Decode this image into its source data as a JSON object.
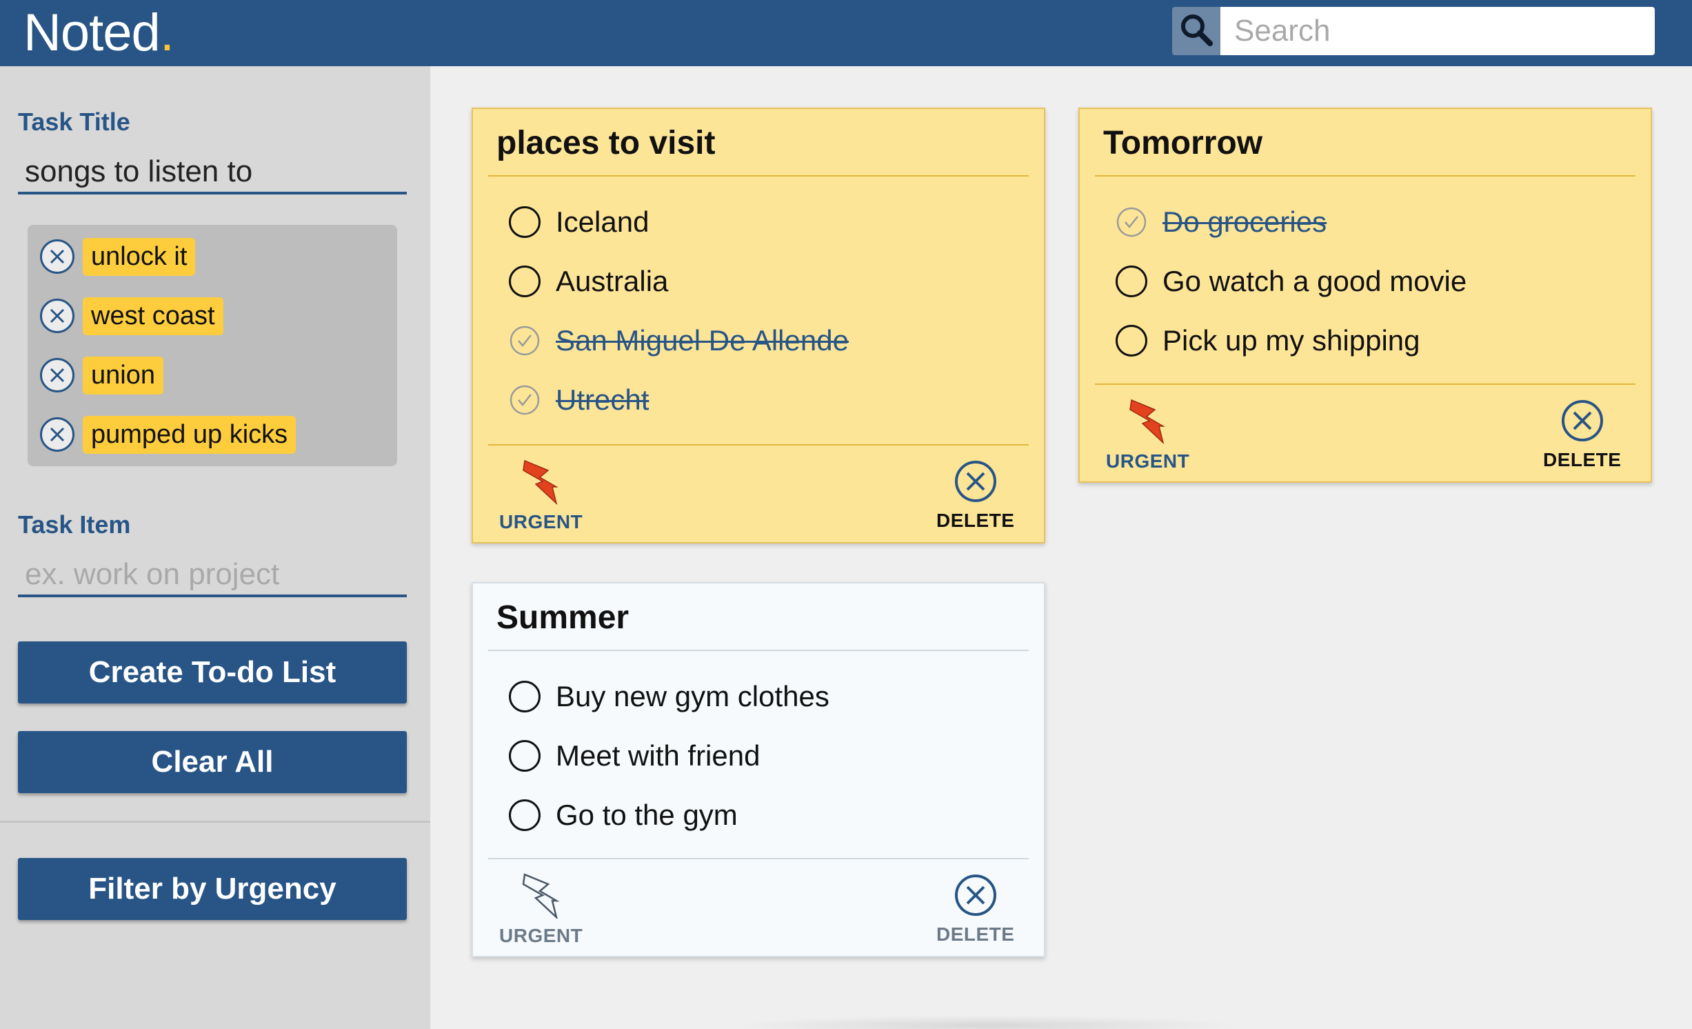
{
  "header": {
    "logo_text": "Noted",
    "logo_dot": ".",
    "search_placeholder": "Search",
    "search_icon": "search-icon"
  },
  "sidebar": {
    "task_title_label": "Task Title",
    "task_title_value": "songs to listen to",
    "draft_items": [
      {
        "label": "unlock it",
        "icon": "close-circle-icon"
      },
      {
        "label": "west coast",
        "icon": "close-circle-icon"
      },
      {
        "label": "union",
        "icon": "close-circle-icon"
      },
      {
        "label": "pumped up kicks",
        "icon": "close-circle-icon"
      }
    ],
    "task_item_label": "Task Item",
    "task_item_placeholder": "ex. work on project",
    "create_button": "Create To-do List",
    "clear_button": "Clear All",
    "filter_button": "Filter by Urgency"
  },
  "cards": [
    {
      "title": "places to visit",
      "urgent": true,
      "items": [
        {
          "text": "Iceland",
          "done": false
        },
        {
          "text": "Australia",
          "done": false
        },
        {
          "text": "San Miguel De Allende",
          "done": true
        },
        {
          "text": "Utrecht",
          "done": true
        }
      ],
      "urgent_label": "URGENT",
      "delete_label": "DELETE"
    },
    {
      "title": "Tomorrow",
      "urgent": true,
      "items": [
        {
          "text": "Do groceries",
          "done": true
        },
        {
          "text": "Go watch a good movie",
          "done": false
        },
        {
          "text": "Pick up my shipping",
          "done": false
        }
      ],
      "urgent_label": "URGENT",
      "delete_label": "DELETE"
    },
    {
      "title": "Summer",
      "urgent": false,
      "items": [
        {
          "text": "Buy new gym clothes",
          "done": false
        },
        {
          "text": "Meet with friend",
          "done": false
        },
        {
          "text": "Go to the gym",
          "done": false
        }
      ],
      "urgent_label": "URGENT",
      "delete_label": "DELETE"
    }
  ],
  "colors": {
    "brand": "#285586",
    "accent": "#f6c33a",
    "urgent_card": "#fde598",
    "lightning_active": "#e3421f"
  }
}
